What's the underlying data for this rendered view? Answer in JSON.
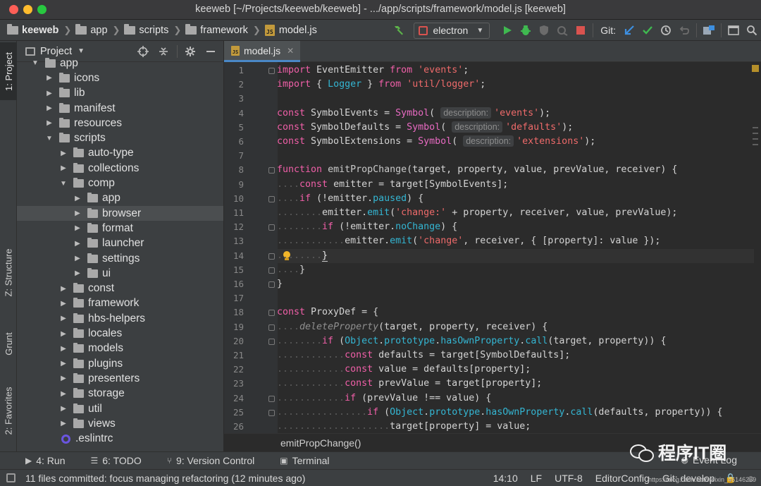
{
  "window": {
    "title": "keeweb [~/Projects/keeweb/keeweb] - .../app/scripts/framework/model.js [keeweb]"
  },
  "toolbar": {
    "breadcrumb": [
      {
        "label": "keeweb",
        "icon": "folder-icon"
      },
      {
        "label": "app",
        "icon": "folder-icon"
      },
      {
        "label": "scripts",
        "icon": "folder-icon"
      },
      {
        "label": "framework",
        "icon": "folder-icon"
      },
      {
        "label": "model.js",
        "icon": "js-file-icon"
      }
    ],
    "run_config": "electron",
    "git_label": "Git:",
    "js_badge": "JS"
  },
  "left_strip": {
    "project": "1: Project",
    "structure": "Z: Structure",
    "grunt": "Grunt",
    "favorites": "2: Favorites"
  },
  "project_panel": {
    "title": "Project",
    "tree": [
      {
        "label": "app",
        "depth": 1,
        "expanded": true,
        "folder": true
      },
      {
        "label": "icons",
        "depth": 2,
        "expanded": false,
        "folder": true
      },
      {
        "label": "lib",
        "depth": 2,
        "expanded": false,
        "folder": true
      },
      {
        "label": "manifest",
        "depth": 2,
        "expanded": false,
        "folder": true
      },
      {
        "label": "resources",
        "depth": 2,
        "expanded": false,
        "folder": true
      },
      {
        "label": "scripts",
        "depth": 2,
        "expanded": true,
        "folder": true
      },
      {
        "label": "auto-type",
        "depth": 3,
        "expanded": false,
        "folder": true
      },
      {
        "label": "collections",
        "depth": 3,
        "expanded": false,
        "folder": true
      },
      {
        "label": "comp",
        "depth": 3,
        "expanded": true,
        "folder": true
      },
      {
        "label": "app",
        "depth": 4,
        "expanded": false,
        "folder": true
      },
      {
        "label": "browser",
        "depth": 4,
        "expanded": false,
        "folder": true,
        "selected": true
      },
      {
        "label": "format",
        "depth": 4,
        "expanded": false,
        "folder": true
      },
      {
        "label": "launcher",
        "depth": 4,
        "expanded": false,
        "folder": true
      },
      {
        "label": "settings",
        "depth": 4,
        "expanded": false,
        "folder": true
      },
      {
        "label": "ui",
        "depth": 4,
        "expanded": false,
        "folder": true
      },
      {
        "label": "const",
        "depth": 3,
        "expanded": false,
        "folder": true
      },
      {
        "label": "framework",
        "depth": 3,
        "expanded": false,
        "folder": true
      },
      {
        "label": "hbs-helpers",
        "depth": 3,
        "expanded": false,
        "folder": true
      },
      {
        "label": "locales",
        "depth": 3,
        "expanded": false,
        "folder": true
      },
      {
        "label": "models",
        "depth": 3,
        "expanded": false,
        "folder": true
      },
      {
        "label": "plugins",
        "depth": 3,
        "expanded": false,
        "folder": true
      },
      {
        "label": "presenters",
        "depth": 3,
        "expanded": false,
        "folder": true
      },
      {
        "label": "storage",
        "depth": 3,
        "expanded": false,
        "folder": true
      },
      {
        "label": "util",
        "depth": 3,
        "expanded": false,
        "folder": true
      },
      {
        "label": "views",
        "depth": 3,
        "expanded": false,
        "folder": true
      },
      {
        "label": ".eslintrc",
        "depth": 3,
        "expanded": false,
        "folder": false
      }
    ]
  },
  "editor": {
    "tab": "model.js",
    "current_line": 14,
    "lines": [
      {
        "n": 1,
        "tokens": [
          [
            "k",
            "import"
          ],
          [
            "t",
            " EventEmitter "
          ],
          [
            "k",
            "from"
          ],
          [
            "t",
            " "
          ],
          [
            "s",
            "'events'"
          ],
          [
            "t",
            ";"
          ]
        ]
      },
      {
        "n": 2,
        "tokens": [
          [
            "k",
            "import"
          ],
          [
            "t",
            " { "
          ],
          [
            "p",
            "Logger"
          ],
          [
            "t",
            " } "
          ],
          [
            "k",
            "from"
          ],
          [
            "t",
            " "
          ],
          [
            "s",
            "'util/logger'"
          ],
          [
            "t",
            ";"
          ]
        ]
      },
      {
        "n": 3,
        "tokens": []
      },
      {
        "n": 4,
        "tokens": [
          [
            "k",
            "const"
          ],
          [
            "t",
            " SymbolEvents = "
          ],
          [
            "sym",
            "Symbol"
          ],
          [
            "t",
            "( "
          ],
          [
            "h",
            "description:"
          ],
          [
            "s",
            "'events'"
          ],
          [
            "t",
            ");"
          ]
        ]
      },
      {
        "n": 5,
        "tokens": [
          [
            "k",
            "const"
          ],
          [
            "t",
            " SymbolDefaults = "
          ],
          [
            "sym",
            "Symbol"
          ],
          [
            "t",
            "( "
          ],
          [
            "h",
            "description:"
          ],
          [
            "s",
            "'defaults'"
          ],
          [
            "t",
            ");"
          ]
        ]
      },
      {
        "n": 6,
        "tokens": [
          [
            "k",
            "const"
          ],
          [
            "t",
            " SymbolExtensions = "
          ],
          [
            "sym",
            "Symbol"
          ],
          [
            "t",
            "( "
          ],
          [
            "h",
            "description:"
          ],
          [
            "s",
            "'extensions'"
          ],
          [
            "t",
            ");"
          ]
        ]
      },
      {
        "n": 7,
        "tokens": []
      },
      {
        "n": 8,
        "tokens": [
          [
            "k",
            "function"
          ],
          [
            "t",
            " "
          ],
          [
            "f",
            "emitPropChange"
          ],
          [
            "t",
            "(target, property, value, prevValue, receiver) {"
          ]
        ]
      },
      {
        "n": 9,
        "tokens": [
          [
            "d",
            "...."
          ],
          [
            "k",
            "const"
          ],
          [
            "t",
            " emitter = target[SymbolEvents];"
          ]
        ]
      },
      {
        "n": 10,
        "tokens": [
          [
            "d",
            "...."
          ],
          [
            "k",
            "if"
          ],
          [
            "t",
            " (!emitter."
          ],
          [
            "p",
            "paused"
          ],
          [
            "t",
            ") {"
          ]
        ]
      },
      {
        "n": 11,
        "tokens": [
          [
            "d",
            "........"
          ],
          [
            "t",
            "emitter."
          ],
          [
            "p",
            "emit"
          ],
          [
            "t",
            "("
          ],
          [
            "s",
            "'change:'"
          ],
          [
            "t",
            " + property, receiver, value, prevValue);"
          ]
        ]
      },
      {
        "n": 12,
        "tokens": [
          [
            "d",
            "........"
          ],
          [
            "k",
            "if"
          ],
          [
            "t",
            " (!emitter."
          ],
          [
            "p",
            "noChange"
          ],
          [
            "t",
            ") {"
          ]
        ]
      },
      {
        "n": 13,
        "tokens": [
          [
            "d",
            "............"
          ],
          [
            "t",
            "emitter."
          ],
          [
            "p",
            "emit"
          ],
          [
            "t",
            "("
          ],
          [
            "s",
            "'change'"
          ],
          [
            "t",
            ", receiver, { [property]: value });"
          ]
        ]
      },
      {
        "n": 14,
        "tokens": [
          [
            "d",
            "........"
          ],
          [
            "b",
            "}"
          ]
        ]
      },
      {
        "n": 15,
        "tokens": [
          [
            "d",
            "...."
          ],
          [
            "t",
            "}"
          ]
        ]
      },
      {
        "n": 16,
        "tokens": [
          [
            "t",
            "}"
          ]
        ]
      },
      {
        "n": 17,
        "tokens": []
      },
      {
        "n": 18,
        "tokens": [
          [
            "k",
            "const"
          ],
          [
            "t",
            " ProxyDef = {"
          ]
        ]
      },
      {
        "n": 19,
        "tokens": [
          [
            "d",
            "...."
          ],
          [
            "m",
            "deleteProperty"
          ],
          [
            "t",
            "(target, property, receiver) {"
          ]
        ]
      },
      {
        "n": 20,
        "tokens": [
          [
            "d",
            "........"
          ],
          [
            "k",
            "if"
          ],
          [
            "t",
            " ("
          ],
          [
            "p",
            "Object"
          ],
          [
            "t",
            "."
          ],
          [
            "p",
            "prototype"
          ],
          [
            "t",
            "."
          ],
          [
            "p",
            "hasOwnProperty"
          ],
          [
            "t",
            "."
          ],
          [
            "p",
            "call"
          ],
          [
            "t",
            "(target, property)) {"
          ]
        ]
      },
      {
        "n": 21,
        "tokens": [
          [
            "d",
            "............"
          ],
          [
            "k",
            "const"
          ],
          [
            "t",
            " defaults = target[SymbolDefaults];"
          ]
        ]
      },
      {
        "n": 22,
        "tokens": [
          [
            "d",
            "............"
          ],
          [
            "k",
            "const"
          ],
          [
            "t",
            " value = defaults[property];"
          ]
        ]
      },
      {
        "n": 23,
        "tokens": [
          [
            "d",
            "............"
          ],
          [
            "k",
            "const"
          ],
          [
            "t",
            " prevValue = target[property];"
          ]
        ]
      },
      {
        "n": 24,
        "tokens": [
          [
            "d",
            "............"
          ],
          [
            "k",
            "if"
          ],
          [
            "t",
            " (prevValue !== value) {"
          ]
        ]
      },
      {
        "n": 25,
        "tokens": [
          [
            "d",
            "................"
          ],
          [
            "k",
            "if"
          ],
          [
            "t",
            " ("
          ],
          [
            "p",
            "Object"
          ],
          [
            "t",
            "."
          ],
          [
            "p",
            "prototype"
          ],
          [
            "t",
            "."
          ],
          [
            "p",
            "hasOwnProperty"
          ],
          [
            "t",
            "."
          ],
          [
            "p",
            "call"
          ],
          [
            "t",
            "(defaults, property)) {"
          ]
        ]
      },
      {
        "n": 26,
        "tokens": [
          [
            "d",
            "...................."
          ],
          [
            "t",
            "target[property] = value;"
          ]
        ]
      }
    ],
    "bottom_breadcrumb": "emitPropChange()"
  },
  "tool_windows": {
    "run": "4: Run",
    "todo": "6: TODO",
    "version_control": "9: Version Control",
    "terminal": "Terminal",
    "event_log": "Event Log"
  },
  "status_bar": {
    "message": "11 files committed: focus managing refactoring (12 minutes ago)",
    "position": "14:10",
    "line_sep": "LF",
    "encoding": "UTF-8",
    "editor_config": "EditorConfig",
    "git_branch": "Git: develop"
  },
  "watermark": {
    "text": "程序IT圈",
    "url": "https://blog.csdn.net/weixin_46146269"
  },
  "colors": {
    "keyword": "#f05fa8",
    "string": "#ee6a6a",
    "property": "#34b6d3",
    "run_green": "#3fb950",
    "selection": "#4b4e50",
    "accent_blue": "#4a88c7"
  }
}
